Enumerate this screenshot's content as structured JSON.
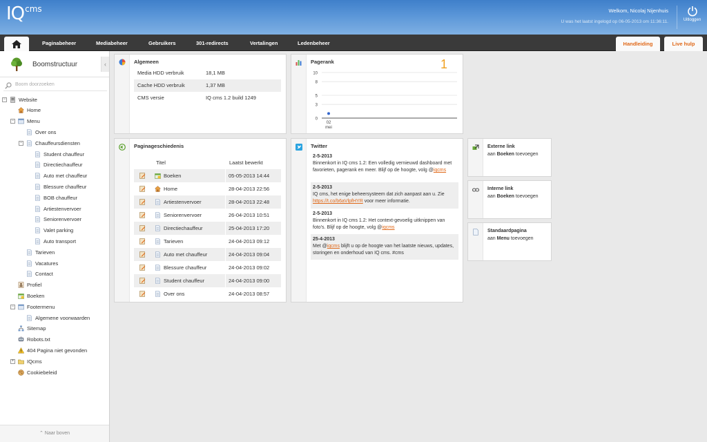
{
  "header": {
    "logo_main": "IQ",
    "logo_sup": "cms",
    "welcome": "Welkom, Nicolaj Nijenhuis",
    "last_login": "U was het laatst ingelogd op 06-05-2013 om 11:36:11.",
    "logout_label": "Uitloggen"
  },
  "nav": {
    "items": [
      "Paginabeheer",
      "Mediabeheer",
      "Gebruikers",
      "301-redirects",
      "Vertalingen",
      "Ledenbeheer"
    ],
    "manual": "Handleiding",
    "live_help": "Live hulp"
  },
  "sidebar": {
    "title": "Boomstructuur",
    "search_placeholder": "Boom doorzoeken",
    "back_to_top": "Naar boven",
    "tree": [
      {
        "label": "Website",
        "icon": "server-icon",
        "level": 0,
        "toggle": "-"
      },
      {
        "label": "Home",
        "icon": "home-icon",
        "level": 1
      },
      {
        "label": "Menu",
        "icon": "menu-icon",
        "level": 1,
        "toggle": "-"
      },
      {
        "label": "Over ons",
        "icon": "page-icon",
        "level": 2
      },
      {
        "label": "Chauffeursdiensten",
        "icon": "page-icon",
        "level": 2,
        "toggle": "-"
      },
      {
        "label": "Student chauffeur",
        "icon": "page-icon",
        "level": 3
      },
      {
        "label": "Directiechauffeur",
        "icon": "page-icon",
        "level": 3
      },
      {
        "label": "Auto met chauffeur",
        "icon": "page-icon",
        "level": 3
      },
      {
        "label": "Blessure chauffeur",
        "icon": "page-icon",
        "level": 3
      },
      {
        "label": "BOB chauffeur",
        "icon": "page-icon",
        "level": 3
      },
      {
        "label": "Artiestenvervoer",
        "icon": "page-icon",
        "level": 3
      },
      {
        "label": "Seniorenvervoer",
        "icon": "page-icon",
        "level": 3
      },
      {
        "label": "Valet parking",
        "icon": "page-icon",
        "level": 3
      },
      {
        "label": "Auto transport",
        "icon": "page-icon",
        "level": 3
      },
      {
        "label": "Tarieven",
        "icon": "page-icon",
        "level": 2
      },
      {
        "label": "Vacatures",
        "icon": "page-icon",
        "level": 2
      },
      {
        "label": "Contact",
        "icon": "page-icon",
        "level": 2
      },
      {
        "label": "Profiel",
        "icon": "profile-icon",
        "level": 1
      },
      {
        "label": "Boeken",
        "icon": "booking-icon",
        "level": 1
      },
      {
        "label": "Footermenu",
        "icon": "menu-icon",
        "level": 1,
        "toggle": "-"
      },
      {
        "label": "Algemene voorwaarden",
        "icon": "page-icon",
        "level": 2
      },
      {
        "label": "Sitemap",
        "icon": "sitemap-icon",
        "level": 1
      },
      {
        "label": "Robots.txt",
        "icon": "robot-icon",
        "level": 1
      },
      {
        "label": "404 Pagina niet gevonden",
        "icon": "warning-icon",
        "level": 1
      },
      {
        "label": "IQcms",
        "icon": "folder-icon",
        "level": 1,
        "toggle": "+"
      },
      {
        "label": "Cookiebeleid",
        "icon": "cookie-icon",
        "level": 1
      }
    ]
  },
  "general": {
    "title": "Algemeen",
    "rows": [
      {
        "label": "Media HDD verbruik",
        "value": "18,1 MB"
      },
      {
        "label": "Cache HDD verbruik",
        "value": "1,37 MB"
      },
      {
        "label": "CMS versie",
        "value": "IQ cms 1.2 build 1249"
      }
    ]
  },
  "pagerank": {
    "title": "Pagerank",
    "value": "1",
    "chart_data": {
      "type": "line",
      "x": [
        "02 mei"
      ],
      "x_tick_labels": [
        "02",
        "mei"
      ],
      "values": [
        1
      ],
      "yticks": [
        0,
        3,
        5,
        8,
        10
      ],
      "ylim": [
        0,
        10
      ],
      "grid": true
    }
  },
  "history": {
    "title": "Paginageschiedenis",
    "col_title": "Titel",
    "col_date": "Laatst bewerkt",
    "rows": [
      {
        "title": "Boeken",
        "date": "05-05-2013 14:44"
      },
      {
        "title": "Home",
        "date": "28-04-2013 22:56"
      },
      {
        "title": "Artiestenvervoer",
        "date": "28-04-2013 22:48"
      },
      {
        "title": "Seniorenvervoer",
        "date": "26-04-2013 10:51"
      },
      {
        "title": "Directiechauffeur",
        "date": "25-04-2013 17:20"
      },
      {
        "title": "Tarieven",
        "date": "24-04-2013 09:12"
      },
      {
        "title": "Auto met chauffeur",
        "date": "24-04-2013 09:04"
      },
      {
        "title": "Blessure chauffeur",
        "date": "24-04-2013 09:02"
      },
      {
        "title": "Student chauffeur",
        "date": "24-04-2013 09:00"
      },
      {
        "title": "Over ons",
        "date": "24-04-2013 08:57"
      }
    ]
  },
  "twitter": {
    "title": "Twitter",
    "tweets": [
      {
        "date": "2-5-2013",
        "text": "Binnenkort in IQ cms 1.2: Een volledig vernieuwd dashboard met favorieten, pagerank en meer. Blijf op de hoogte, volg @",
        "link": "iqcms",
        "after": ""
      },
      {
        "date": "2-5-2013",
        "text": "IQ cms, het enige beheersysteem dat zich aanpast aan u. Zie ",
        "link": "https://t.co/b6aVlpfHYR",
        "after": " voor meer informatie."
      },
      {
        "date": "2-5-2013",
        "text": "Binnenkort in IQ cms 1.2: Het context-gevoelig uitknippen van foto's. Blijf op de hoogte, volg @",
        "link": "iqcms",
        "after": ""
      },
      {
        "date": "25-4-2013",
        "text": "Met @",
        "link": "iqcms",
        "after": " blijft u op de hoogte van het laatste nieuws, updates, storingen en onderhoud van IQ cms. #cms"
      }
    ]
  },
  "shortcuts": [
    {
      "title": "Externe link",
      "pre": "aan ",
      "target": "Boeken",
      "post": " toevoegen"
    },
    {
      "title": "Interne link",
      "pre": "aan ",
      "target": "Boeken",
      "post": " toevoegen"
    },
    {
      "title": "Standaardpagina",
      "pre": "aan ",
      "target": "Menu",
      "post": " toevoegen"
    }
  ],
  "colors": {
    "header_blue": "#4f8ed4",
    "nav_dark": "#3a3a3a",
    "accent_orange": "#e06818",
    "chart_dot": "#3366cc"
  }
}
